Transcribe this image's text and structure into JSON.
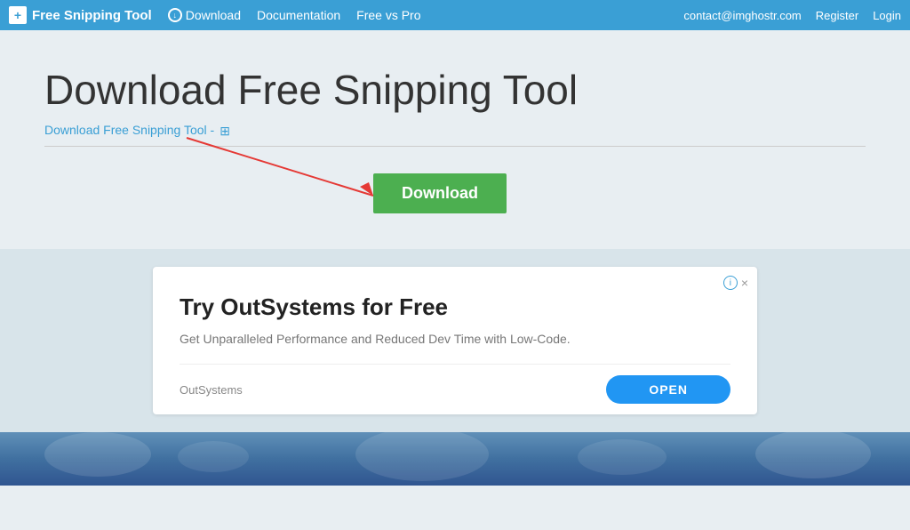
{
  "navbar": {
    "brand": "Free Snipping Tool",
    "brand_icon": "+",
    "nav_items": [
      {
        "label": "Download",
        "has_icon": true
      },
      {
        "label": "Documentation"
      },
      {
        "label": "Free vs Pro"
      }
    ],
    "right_items": [
      {
        "label": "contact@imghostr.com"
      },
      {
        "label": "Register"
      },
      {
        "label": "Login"
      }
    ]
  },
  "main": {
    "page_title": "Download Free Snipping Tool",
    "subtitle_link": "Download Free Snipping Tool -",
    "download_button_label": "Download"
  },
  "ad": {
    "title": "Try OutSystems for Free",
    "description": "Get Unparalleled Performance and Reduced Dev Time with Low-Code.",
    "brand_name": "OutSystems",
    "open_button": "OPEN",
    "close_label": "×",
    "info_label": "ⓘ"
  }
}
